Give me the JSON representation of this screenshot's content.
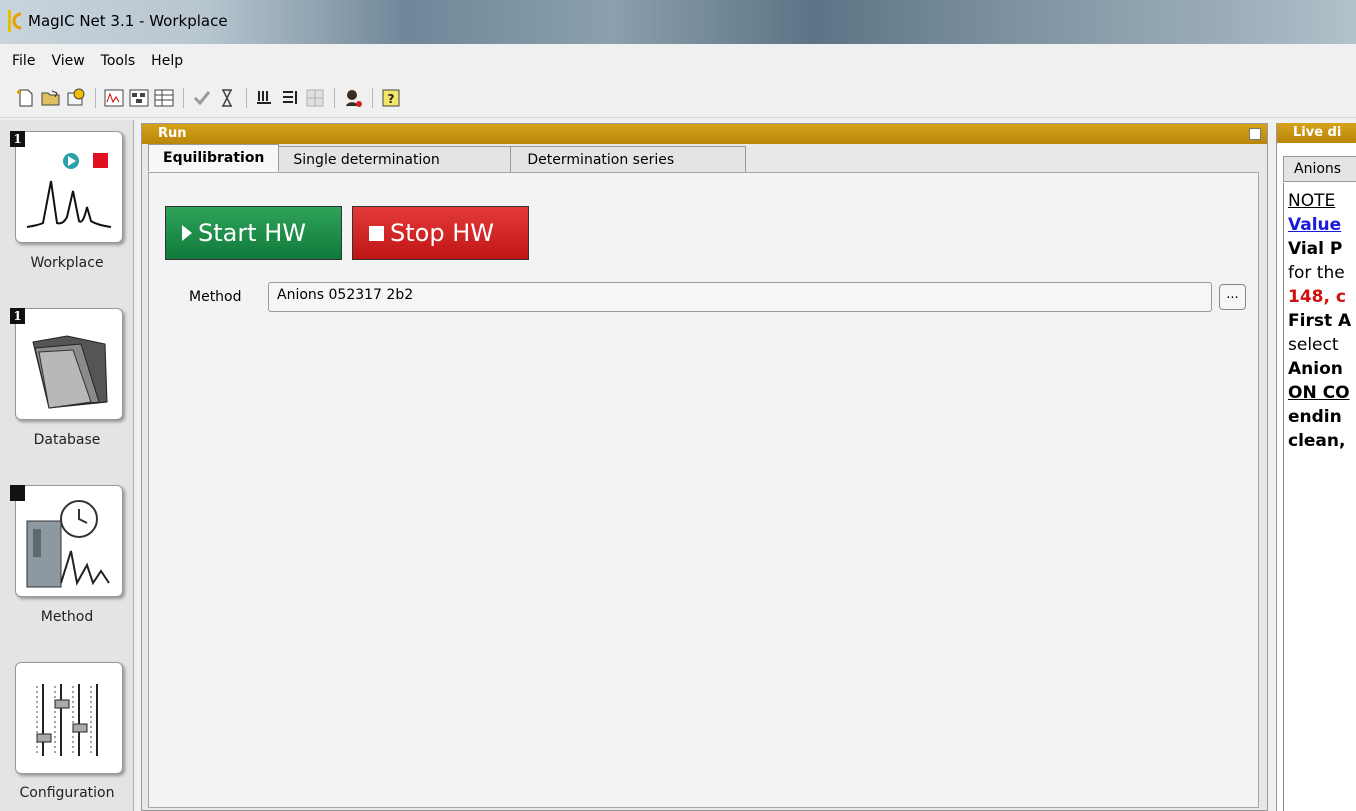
{
  "window": {
    "title": "MagIC Net 3.1 - Workplace"
  },
  "menu": [
    "File",
    "View",
    "Tools",
    "Help"
  ],
  "sidebar": {
    "items": [
      {
        "label": "Workplace",
        "badge": "1"
      },
      {
        "label": "Database",
        "badge": "1"
      },
      {
        "label": "Method",
        "badge": ""
      },
      {
        "label": "Configuration",
        "badge": ""
      }
    ]
  },
  "run": {
    "title": "Run",
    "tabs": [
      "Equilibration",
      "Single determination",
      "Determination series"
    ],
    "start_label": "Start HW",
    "stop_label": "Stop HW",
    "method_label": "Method",
    "method_value": "Anions 052317 2b2",
    "browse_label": "..."
  },
  "live": {
    "title": "Live di",
    "tab": "Anions",
    "lines": [
      "NOTE",
      "Value",
      "Vial P",
      "for the",
      "148, c",
      "First A",
      "select",
      "Anion",
      "ON CO",
      "endin",
      "clean,"
    ]
  },
  "colors": {
    "panel_header": "#c8961a",
    "start_button": "#1e8f4a",
    "stop_button": "#d42626",
    "link_blue": "#1a1adc",
    "alert_red": "#d01010"
  }
}
